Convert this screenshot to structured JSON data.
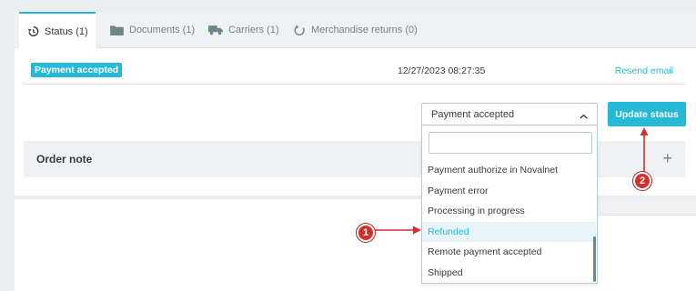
{
  "tabs": [
    {
      "label": "Status (1)",
      "icon": "history-icon",
      "active": true
    },
    {
      "label": "Documents (1)",
      "icon": "folder-icon",
      "active": false
    },
    {
      "label": "Carriers (1)",
      "icon": "truck-icon",
      "active": false
    },
    {
      "label": "Merchandise returns (0)",
      "icon": "return-icon",
      "active": false
    }
  ],
  "status_row": {
    "badge": "Payment accepted",
    "date": "12/27/2023 08:27:35",
    "resend_label": "Resend email"
  },
  "status_select": {
    "selected": "Payment accepted",
    "search_value": "",
    "options": [
      "Payment authorize in Novalnet",
      "Payment error",
      "Processing in progress",
      "Refunded",
      "Remote payment accepted",
      "Shipped"
    ],
    "highlighted": "Refunded"
  },
  "update_button": "Update status",
  "order_note": {
    "title": "Order note",
    "add_symbol": "+"
  },
  "annotations": [
    {
      "number": "1",
      "color": "#d32f2f"
    },
    {
      "number": "2",
      "color": "#d32f2f"
    }
  ],
  "colors": {
    "accent": "#25b9d7",
    "annotation_red": "#d32f2f",
    "background": "#ebeef0"
  }
}
